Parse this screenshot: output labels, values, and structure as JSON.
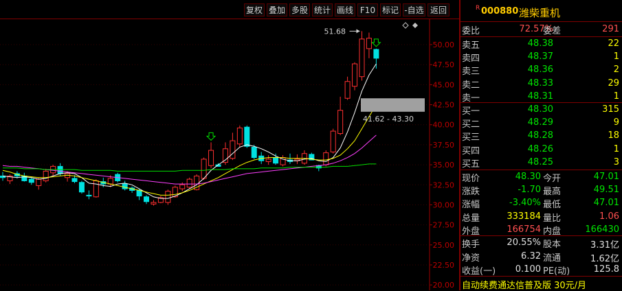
{
  "toolbar": {
    "buttons": [
      "复权",
      "叠加",
      "多股",
      "统计",
      "画线",
      "F10",
      "标记",
      "-自选",
      "返回"
    ]
  },
  "chart": {
    "y_ticks": [
      "50.00",
      "47.50",
      "45.00",
      "42.50",
      "40.00",
      "37.50",
      "35.00",
      "32.50",
      "30.00",
      "27.50",
      "25.00",
      "22.50",
      "20.00"
    ],
    "ylim": [
      19.5,
      53.0
    ],
    "high_label": "51.68",
    "range_label": "41.62 - 43.30",
    "highlight_range": [
      41.62,
      43.3
    ],
    "candles": [
      {
        "o": 33.6,
        "h": 34.1,
        "l": 33.0,
        "c": 33.4
      },
      {
        "o": 33.0,
        "h": 33.8,
        "l": 32.6,
        "c": 33.6
      },
      {
        "o": 33.9,
        "h": 34.2,
        "l": 33.3,
        "c": 33.6
      },
      {
        "o": 33.6,
        "h": 34.0,
        "l": 32.9,
        "c": 33.0
      },
      {
        "o": 33.2,
        "h": 33.5,
        "l": 32.5,
        "c": 32.8
      },
      {
        "o": 32.4,
        "h": 33.4,
        "l": 31.9,
        "c": 33.2
      },
      {
        "o": 33.0,
        "h": 34.5,
        "l": 32.8,
        "c": 34.2
      },
      {
        "o": 34.0,
        "h": 35.0,
        "l": 33.6,
        "c": 34.8
      },
      {
        "o": 34.8,
        "h": 35.2,
        "l": 33.6,
        "c": 33.9
      },
      {
        "o": 33.4,
        "h": 34.2,
        "l": 32.9,
        "c": 33.9
      },
      {
        "o": 33.3,
        "h": 33.7,
        "l": 32.7,
        "c": 32.9
      },
      {
        "o": 32.8,
        "h": 33.0,
        "l": 31.4,
        "c": 31.6
      },
      {
        "o": 31.2,
        "h": 31.8,
        "l": 30.7,
        "c": 31.1
      },
      {
        "o": 31.0,
        "h": 33.2,
        "l": 30.9,
        "c": 33.0
      },
      {
        "o": 32.9,
        "h": 33.4,
        "l": 32.2,
        "c": 32.6
      },
      {
        "o": 32.6,
        "h": 33.7,
        "l": 32.2,
        "c": 33.3
      },
      {
        "o": 33.8,
        "h": 34.0,
        "l": 32.8,
        "c": 33.0
      },
      {
        "o": 32.6,
        "h": 33.0,
        "l": 31.8,
        "c": 32.0
      },
      {
        "o": 32.1,
        "h": 32.3,
        "l": 31.5,
        "c": 31.8
      },
      {
        "o": 31.8,
        "h": 32.0,
        "l": 30.6,
        "c": 31.1
      },
      {
        "o": 31.0,
        "h": 31.2,
        "l": 30.1,
        "c": 30.4
      },
      {
        "o": 30.1,
        "h": 30.6,
        "l": 29.9,
        "c": 30.3
      },
      {
        "o": 30.3,
        "h": 31.1,
        "l": 30.2,
        "c": 30.9
      },
      {
        "o": 30.3,
        "h": 31.9,
        "l": 30.0,
        "c": 31.7
      },
      {
        "o": 31.0,
        "h": 32.4,
        "l": 30.9,
        "c": 32.2
      },
      {
        "o": 32.0,
        "h": 32.8,
        "l": 31.7,
        "c": 32.5
      },
      {
        "o": 32.2,
        "h": 33.4,
        "l": 32.0,
        "c": 33.2
      },
      {
        "o": 31.9,
        "h": 33.8,
        "l": 31.8,
        "c": 33.6
      },
      {
        "o": 33.3,
        "h": 35.9,
        "l": 33.1,
        "c": 35.7
      },
      {
        "o": 34.9,
        "h": 37.8,
        "l": 34.6,
        "c": 36.8
      },
      {
        "o": 35.0,
        "h": 35.2,
        "l": 34.8,
        "c": 34.8
      },
      {
        "o": 35.3,
        "h": 37.8,
        "l": 35.0,
        "c": 37.0
      },
      {
        "o": 35.8,
        "h": 39.0,
        "l": 35.6,
        "c": 38.0
      },
      {
        "o": 37.6,
        "h": 39.9,
        "l": 37.2,
        "c": 39.6
      },
      {
        "o": 39.7,
        "h": 39.9,
        "l": 37.1,
        "c": 37.3
      },
      {
        "o": 37.2,
        "h": 37.5,
        "l": 35.7,
        "c": 35.9
      },
      {
        "o": 36.1,
        "h": 36.6,
        "l": 35.1,
        "c": 35.5
      },
      {
        "o": 35.4,
        "h": 36.2,
        "l": 35.0,
        "c": 35.7
      },
      {
        "o": 35.9,
        "h": 36.4,
        "l": 35.0,
        "c": 35.2
      },
      {
        "o": 35.0,
        "h": 36.2,
        "l": 34.8,
        "c": 35.9
      },
      {
        "o": 35.6,
        "h": 36.4,
        "l": 35.1,
        "c": 35.4
      },
      {
        "o": 35.5,
        "h": 36.3,
        "l": 35.1,
        "c": 35.7
      },
      {
        "o": 35.2,
        "h": 36.8,
        "l": 35.0,
        "c": 36.4
      },
      {
        "o": 36.3,
        "h": 36.5,
        "l": 35.6,
        "c": 35.6
      },
      {
        "o": 34.9,
        "h": 35.0,
        "l": 34.2,
        "c": 34.6
      },
      {
        "o": 35.0,
        "h": 36.8,
        "l": 34.8,
        "c": 36.5
      },
      {
        "o": 36.6,
        "h": 39.5,
        "l": 36.4,
        "c": 39.2
      },
      {
        "o": 38.9,
        "h": 43.5,
        "l": 38.7,
        "c": 41.8
      },
      {
        "o": 43.3,
        "h": 46.0,
        "l": 43.1,
        "c": 45.4
      },
      {
        "o": 44.8,
        "h": 47.8,
        "l": 44.3,
        "c": 47.6
      },
      {
        "o": 46.0,
        "h": 51.68,
        "l": 45.5,
        "c": 50.7
      },
      {
        "o": 49.5,
        "h": 51.5,
        "l": 48.3,
        "c": 50.8
      },
      {
        "o": 49.4,
        "h": 49.5,
        "l": 47.0,
        "c": 48.3
      }
    ],
    "ma_lines": [
      {
        "color": "#ffffff",
        "values": [
          33.6,
          33.5,
          33.4,
          33.5,
          33.4,
          33.2,
          33.3,
          33.6,
          33.9,
          34.0,
          33.9,
          33.4,
          32.7,
          32.6,
          32.4,
          32.3,
          32.6,
          32.7,
          32.5,
          32.0,
          31.5,
          31.0,
          30.8,
          30.8,
          31.1,
          31.5,
          32.0,
          32.5,
          33.3,
          34.3,
          35.0,
          35.6,
          36.4,
          37.2,
          37.5,
          37.3,
          37.0,
          36.6,
          36.1,
          35.7,
          35.5,
          35.5,
          35.7,
          35.8,
          35.5,
          35.4,
          35.9,
          37.1,
          39.1,
          41.5,
          44.2,
          46.2,
          47.6
        ]
      },
      {
        "color": "#ffff00",
        "values": [
          34.3,
          34.1,
          33.8,
          33.6,
          33.5,
          33.4,
          33.4,
          33.5,
          33.6,
          33.7,
          33.6,
          33.4,
          33.2,
          33.0,
          32.8,
          32.6,
          32.4,
          32.2,
          32.0,
          31.8,
          31.6,
          31.4,
          31.2,
          31.2,
          31.3,
          31.5,
          31.8,
          32.2,
          32.6,
          33.0,
          33.4,
          33.9,
          34.4,
          34.9,
          35.3,
          35.6,
          35.8,
          35.9,
          35.9,
          35.9,
          35.8,
          35.8,
          35.8,
          35.7,
          35.6,
          35.6,
          35.8,
          36.2,
          37.0,
          38.0,
          39.5,
          41.0,
          42.5
        ]
      },
      {
        "color": "#ff40ff",
        "values": [
          34.9,
          34.8,
          34.8,
          34.7,
          34.6,
          34.5,
          34.4,
          34.3,
          34.2,
          34.1,
          34.0,
          33.9,
          33.8,
          33.7,
          33.6,
          33.5,
          33.4,
          33.3,
          33.2,
          33.1,
          33.0,
          32.9,
          32.8,
          32.7,
          32.6,
          32.6,
          32.6,
          32.6,
          32.7,
          32.9,
          33.1,
          33.3,
          33.5,
          33.7,
          33.9,
          34.0,
          34.1,
          34.2,
          34.3,
          34.4,
          34.5,
          34.6,
          34.7,
          34.8,
          34.9,
          35.0,
          35.2,
          35.5,
          35.9,
          36.4,
          37.1,
          37.9,
          38.7
        ]
      },
      {
        "color": "#00e000",
        "values": [
          34.6,
          34.6,
          34.6,
          34.5,
          34.5,
          34.5,
          34.4,
          34.4,
          34.4,
          34.4,
          34.4,
          34.3,
          34.3,
          34.3,
          34.3,
          34.3,
          34.2,
          34.2,
          34.2,
          34.2,
          34.2,
          34.2,
          34.2,
          34.2,
          34.2,
          34.3,
          34.3,
          34.3,
          34.3,
          34.4,
          34.4,
          34.4,
          34.5,
          34.5,
          34.5,
          34.5,
          34.6,
          34.6,
          34.6,
          34.6,
          34.7,
          34.7,
          34.7,
          34.7,
          34.7,
          34.7,
          34.8,
          34.8,
          34.8,
          34.9,
          35.0,
          35.1,
          35.1
        ]
      }
    ]
  },
  "quote": {
    "code": "000880",
    "name": "潍柴重机",
    "rzr": "R",
    "weibi_label": "委比",
    "weibi_value": "72.57%",
    "weicha_label": "委差",
    "weicha_value": "291",
    "asks": [
      {
        "label": "卖五",
        "price": "48.38",
        "vol": "22"
      },
      {
        "label": "卖四",
        "price": "48.37",
        "vol": "1"
      },
      {
        "label": "卖三",
        "price": "48.36",
        "vol": "2"
      },
      {
        "label": "卖二",
        "price": "48.33",
        "vol": "29"
      },
      {
        "label": "卖一",
        "price": "48.31",
        "vol": "1"
      }
    ],
    "bids": [
      {
        "label": "买一",
        "price": "48.30",
        "vol": "315"
      },
      {
        "label": "买二",
        "price": "48.29",
        "vol": "9"
      },
      {
        "label": "买三",
        "price": "48.28",
        "vol": "18"
      },
      {
        "label": "买四",
        "price": "48.26",
        "vol": "1"
      },
      {
        "label": "买五",
        "price": "48.25",
        "vol": "3"
      }
    ],
    "stats": [
      {
        "l1": "现价",
        "v1": "48.30",
        "c1": "green",
        "l2": "今开",
        "v2": "47.01",
        "c2": "green"
      },
      {
        "l1": "涨跌",
        "v1": "-1.70",
        "c1": "green",
        "l2": "最高",
        "v2": "49.51",
        "c2": "green"
      },
      {
        "l1": "涨幅",
        "v1": "-3.40%",
        "c1": "green",
        "l2": "最低",
        "v2": "47.01",
        "c2": "green"
      },
      {
        "l1": "总量",
        "v1": "333184",
        "c1": "yellow",
        "l2": "量比",
        "v2": "1.06",
        "c2": "red"
      },
      {
        "l1": "外盘",
        "v1": "166754",
        "c1": "red",
        "l2": "内盘",
        "v2": "166430",
        "c2": "green"
      }
    ],
    "stats2": [
      {
        "l1": "换手",
        "v1": "20.55%",
        "l2": "股本",
        "v2": "3.31亿"
      },
      {
        "l1": "净资",
        "v1": "6.32",
        "l2": "流通",
        "v2": "1.62亿"
      },
      {
        "l1": "收益(一)",
        "v1": "0.100",
        "l2": "PE(动)",
        "v2": "125.8"
      }
    ],
    "footer": "自动续费通达信普及版 30元/月"
  }
}
